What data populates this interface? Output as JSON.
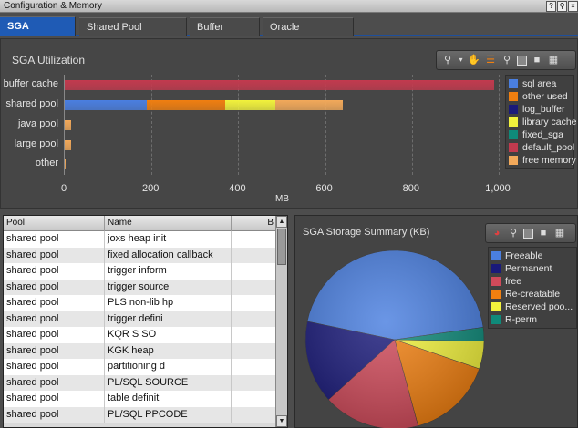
{
  "window": {
    "title": "Configuration & Memory",
    "controls": [
      "question-icon",
      "search-icon",
      "close-icon"
    ]
  },
  "tabs": [
    {
      "label": "SGA Utilization",
      "active": true
    },
    {
      "label": "Shared Pool Utilization",
      "active": false
    },
    {
      "label": "Buffer Cache",
      "active": false
    },
    {
      "label": "Oracle Parameters",
      "active": false
    }
  ],
  "sga_panel": {
    "title": "SGA Utilization",
    "toolbar": [
      "zoom-icon",
      "chevron-down-icon",
      "hand-pan-icon",
      "chart-type-icon",
      "pin-icon",
      "window-icon",
      "save-icon",
      "print-icon"
    ]
  },
  "storage_panel": {
    "title": "SGA Storage Summary (KB)",
    "toolbar": [
      "pie-chart-icon",
      "pin-icon",
      "window-icon",
      "save-icon",
      "print-icon"
    ]
  },
  "table": {
    "columns": [
      "Pool",
      "Name",
      "B"
    ],
    "rows": [
      [
        "shared pool",
        "joxs heap init",
        ""
      ],
      [
        "shared pool",
        "fixed allocation callback",
        ""
      ],
      [
        "shared pool",
        "trigger inform",
        ""
      ],
      [
        "shared pool",
        "trigger source",
        ""
      ],
      [
        "shared pool",
        "PLS non-lib hp",
        ""
      ],
      [
        "shared pool",
        "trigger defini",
        ""
      ],
      [
        "shared pool",
        "KQR S SO",
        ""
      ],
      [
        "shared pool",
        "KGK heap",
        ""
      ],
      [
        "shared pool",
        "partitioning d",
        ""
      ],
      [
        "shared pool",
        "PL/SQL SOURCE",
        ""
      ],
      [
        "shared pool",
        "table definiti",
        ""
      ],
      [
        "shared pool",
        "PL/SQL PPCODE",
        ""
      ]
    ]
  },
  "colors": {
    "sql area": "#4a7fe0",
    "other used": "#f07f10",
    "log_buffer": "#1a1a7a",
    "library cache": "#f2f23c",
    "fixed_sga": "#0f8a7a",
    "default_pool": "#c23a4e",
    "free memory": "#f2a95a",
    "Freeable": "#4a7fe0",
    "Permanent": "#1a1a7a",
    "free": "#d04a5a",
    "Re-creatable": "#f07f10",
    "Reserved poo...": "#f2f23c",
    "R-perm": "#0f8a7a"
  },
  "chart_data": [
    {
      "type": "bar",
      "orientation": "horizontal",
      "title": "SGA Utilization",
      "xlabel": "MB",
      "ylabel": "",
      "xlim": [
        0,
        1000
      ],
      "xticks": [
        "0",
        "200",
        "400",
        "600",
        "800",
        "1,000"
      ],
      "categories": [
        "buffer cache",
        "shared pool",
        "java pool",
        "large pool",
        "other"
      ],
      "series": [
        {
          "name": "sql area",
          "values": [
            0,
            190,
            0,
            0,
            0
          ]
        },
        {
          "name": "other used",
          "values": [
            0,
            180,
            0,
            0,
            0
          ]
        },
        {
          "name": "log_buffer",
          "values": [
            0,
            0,
            0,
            0,
            0
          ]
        },
        {
          "name": "library cache",
          "values": [
            0,
            115,
            0,
            0,
            0
          ]
        },
        {
          "name": "fixed_sga",
          "values": [
            0,
            0,
            0,
            0,
            0
          ]
        },
        {
          "name": "default_pool",
          "values": [
            990,
            0,
            0,
            0,
            0
          ]
        },
        {
          "name": "free memory",
          "values": [
            0,
            155,
            15,
            15,
            2
          ]
        }
      ],
      "legend": "right",
      "grid": true
    },
    {
      "type": "pie",
      "title": "SGA Storage Summary (KB)",
      "labels": [
        "Freeable",
        "Permanent",
        "free",
        "Re-creatable",
        "Reserved poo...",
        "R-perm"
      ],
      "values": [
        44.5,
        15,
        17.5,
        15.5,
        5,
        2.5
      ],
      "legend": "top-right"
    }
  ]
}
